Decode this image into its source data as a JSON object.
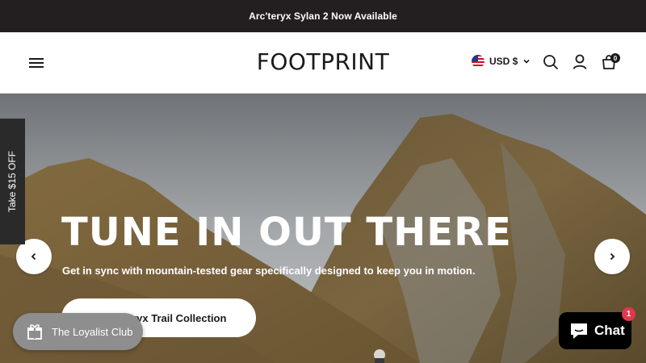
{
  "announcement": {
    "text": "Arc'teryx Sylan 2 Now Available"
  },
  "header": {
    "menu_icon": "hamburger-icon",
    "logo": "FOOTPRINT",
    "currency": {
      "label": "USD $",
      "flag_icon": "us-flag-icon"
    },
    "search_icon": "search-icon",
    "account_icon": "user-icon",
    "cart": {
      "icon": "bag-icon",
      "count": "0"
    }
  },
  "hero": {
    "title": "TUNE IN OUT THERE",
    "subtitle": "Get in sync with mountain-tested gear specifically designed to keep you in motion.",
    "cta_label": "teryx Trail Collection",
    "prev_icon": "chevron-left-icon",
    "next_icon": "chevron-right-icon"
  },
  "side_tab": {
    "label": "Take $15 OFF"
  },
  "loyalty": {
    "label": "The Loyalist Club",
    "icon": "gift-icon"
  },
  "chat": {
    "label": "Chat",
    "icon": "chat-bubble-icon",
    "badge": "1"
  },
  "colors": {
    "announcement_bg": "#231f20",
    "chat_badge": "#e2384d",
    "loyalty_bg": "#8e8e8e"
  }
}
